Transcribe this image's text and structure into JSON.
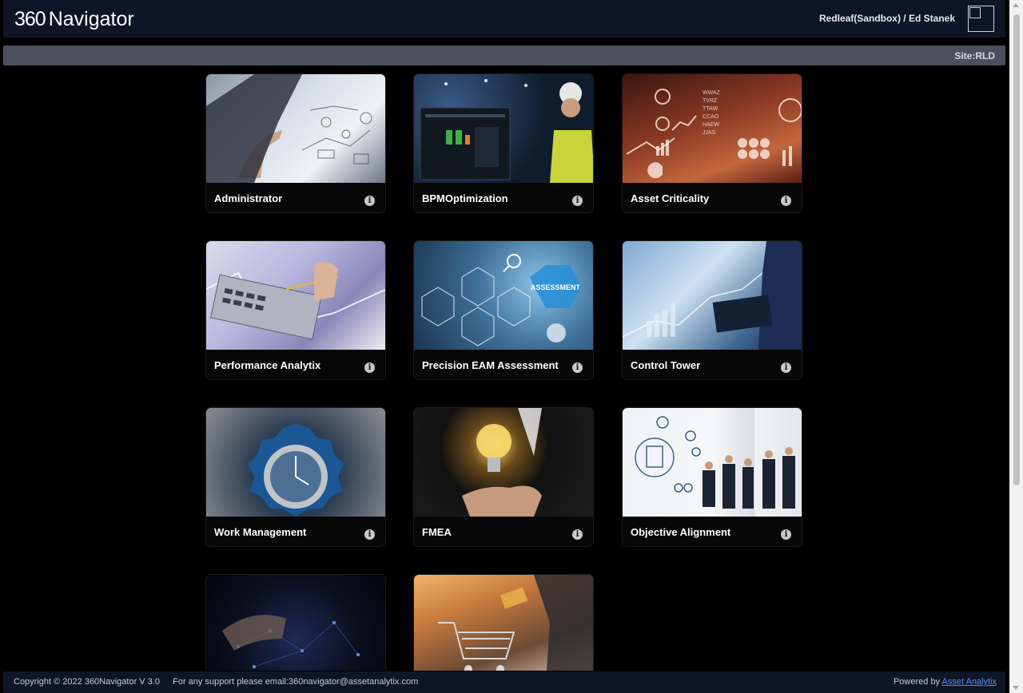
{
  "header": {
    "logo_number": "360",
    "logo_text": "Navigator",
    "user": "Redleaf(Sandbox) / Ed Stanek"
  },
  "site_bar": {
    "label": "Site:RLD"
  },
  "tiles": [
    {
      "label": "Administrator",
      "image": "business-touch-screen"
    },
    {
      "label": "BPMOptimization",
      "image": "engineer-with-monitor"
    },
    {
      "label": "Asset Criticality",
      "image": "data-dashboard-orange"
    },
    {
      "label": "Performance Analytix",
      "image": "calculator-and-pen"
    },
    {
      "label": "Precision EAM Assessment",
      "image": "assessment-hexagons"
    },
    {
      "label": "Control Tower",
      "image": "tablet-graph-overlay"
    },
    {
      "label": "Work Management",
      "image": "gear-clock"
    },
    {
      "label": "FMEA",
      "image": "lightbulb-hand"
    },
    {
      "label": "Objective Alignment",
      "image": "business-meeting-whiteboard"
    },
    {
      "label": "",
      "image": "data-network-hand"
    },
    {
      "label": "",
      "image": "shopping-cart"
    }
  ],
  "footer": {
    "copyright": "Copyright © 2022 360Navigator V 3.0",
    "support": "For any support please email:360navigator@assetanalytix.com",
    "powered_by": "Powered by",
    "powered_link": "Asset Analytix"
  },
  "colors": {
    "background": "#000000",
    "header": "#0e1526",
    "site_bar": "#4a505c",
    "link": "#5b8dfc"
  }
}
